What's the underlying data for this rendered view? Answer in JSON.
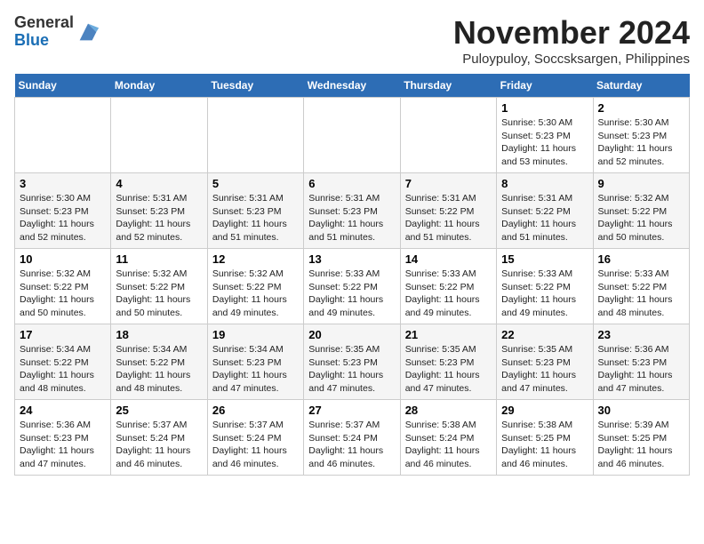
{
  "logo": {
    "line1": "General",
    "line2": "Blue"
  },
  "title": "November 2024",
  "location": "Puloypuloy, Soccsksargen, Philippines",
  "weekdays": [
    "Sunday",
    "Monday",
    "Tuesday",
    "Wednesday",
    "Thursday",
    "Friday",
    "Saturday"
  ],
  "weeks": [
    [
      {
        "day": "",
        "info": ""
      },
      {
        "day": "",
        "info": ""
      },
      {
        "day": "",
        "info": ""
      },
      {
        "day": "",
        "info": ""
      },
      {
        "day": "",
        "info": ""
      },
      {
        "day": "1",
        "info": "Sunrise: 5:30 AM\nSunset: 5:23 PM\nDaylight: 11 hours\nand 53 minutes."
      },
      {
        "day": "2",
        "info": "Sunrise: 5:30 AM\nSunset: 5:23 PM\nDaylight: 11 hours\nand 52 minutes."
      }
    ],
    [
      {
        "day": "3",
        "info": "Sunrise: 5:30 AM\nSunset: 5:23 PM\nDaylight: 11 hours\nand 52 minutes."
      },
      {
        "day": "4",
        "info": "Sunrise: 5:31 AM\nSunset: 5:23 PM\nDaylight: 11 hours\nand 52 minutes."
      },
      {
        "day": "5",
        "info": "Sunrise: 5:31 AM\nSunset: 5:23 PM\nDaylight: 11 hours\nand 51 minutes."
      },
      {
        "day": "6",
        "info": "Sunrise: 5:31 AM\nSunset: 5:23 PM\nDaylight: 11 hours\nand 51 minutes."
      },
      {
        "day": "7",
        "info": "Sunrise: 5:31 AM\nSunset: 5:22 PM\nDaylight: 11 hours\nand 51 minutes."
      },
      {
        "day": "8",
        "info": "Sunrise: 5:31 AM\nSunset: 5:22 PM\nDaylight: 11 hours\nand 51 minutes."
      },
      {
        "day": "9",
        "info": "Sunrise: 5:32 AM\nSunset: 5:22 PM\nDaylight: 11 hours\nand 50 minutes."
      }
    ],
    [
      {
        "day": "10",
        "info": "Sunrise: 5:32 AM\nSunset: 5:22 PM\nDaylight: 11 hours\nand 50 minutes."
      },
      {
        "day": "11",
        "info": "Sunrise: 5:32 AM\nSunset: 5:22 PM\nDaylight: 11 hours\nand 50 minutes."
      },
      {
        "day": "12",
        "info": "Sunrise: 5:32 AM\nSunset: 5:22 PM\nDaylight: 11 hours\nand 49 minutes."
      },
      {
        "day": "13",
        "info": "Sunrise: 5:33 AM\nSunset: 5:22 PM\nDaylight: 11 hours\nand 49 minutes."
      },
      {
        "day": "14",
        "info": "Sunrise: 5:33 AM\nSunset: 5:22 PM\nDaylight: 11 hours\nand 49 minutes."
      },
      {
        "day": "15",
        "info": "Sunrise: 5:33 AM\nSunset: 5:22 PM\nDaylight: 11 hours\nand 49 minutes."
      },
      {
        "day": "16",
        "info": "Sunrise: 5:33 AM\nSunset: 5:22 PM\nDaylight: 11 hours\nand 48 minutes."
      }
    ],
    [
      {
        "day": "17",
        "info": "Sunrise: 5:34 AM\nSunset: 5:22 PM\nDaylight: 11 hours\nand 48 minutes."
      },
      {
        "day": "18",
        "info": "Sunrise: 5:34 AM\nSunset: 5:22 PM\nDaylight: 11 hours\nand 48 minutes."
      },
      {
        "day": "19",
        "info": "Sunrise: 5:34 AM\nSunset: 5:23 PM\nDaylight: 11 hours\nand 47 minutes."
      },
      {
        "day": "20",
        "info": "Sunrise: 5:35 AM\nSunset: 5:23 PM\nDaylight: 11 hours\nand 47 minutes."
      },
      {
        "day": "21",
        "info": "Sunrise: 5:35 AM\nSunset: 5:23 PM\nDaylight: 11 hours\nand 47 minutes."
      },
      {
        "day": "22",
        "info": "Sunrise: 5:35 AM\nSunset: 5:23 PM\nDaylight: 11 hours\nand 47 minutes."
      },
      {
        "day": "23",
        "info": "Sunrise: 5:36 AM\nSunset: 5:23 PM\nDaylight: 11 hours\nand 47 minutes."
      }
    ],
    [
      {
        "day": "24",
        "info": "Sunrise: 5:36 AM\nSunset: 5:23 PM\nDaylight: 11 hours\nand 47 minutes."
      },
      {
        "day": "25",
        "info": "Sunrise: 5:37 AM\nSunset: 5:24 PM\nDaylight: 11 hours\nand 46 minutes."
      },
      {
        "day": "26",
        "info": "Sunrise: 5:37 AM\nSunset: 5:24 PM\nDaylight: 11 hours\nand 46 minutes."
      },
      {
        "day": "27",
        "info": "Sunrise: 5:37 AM\nSunset: 5:24 PM\nDaylight: 11 hours\nand 46 minutes."
      },
      {
        "day": "28",
        "info": "Sunrise: 5:38 AM\nSunset: 5:24 PM\nDaylight: 11 hours\nand 46 minutes."
      },
      {
        "day": "29",
        "info": "Sunrise: 5:38 AM\nSunset: 5:25 PM\nDaylight: 11 hours\nand 46 minutes."
      },
      {
        "day": "30",
        "info": "Sunrise: 5:39 AM\nSunset: 5:25 PM\nDaylight: 11 hours\nand 46 minutes."
      }
    ]
  ]
}
